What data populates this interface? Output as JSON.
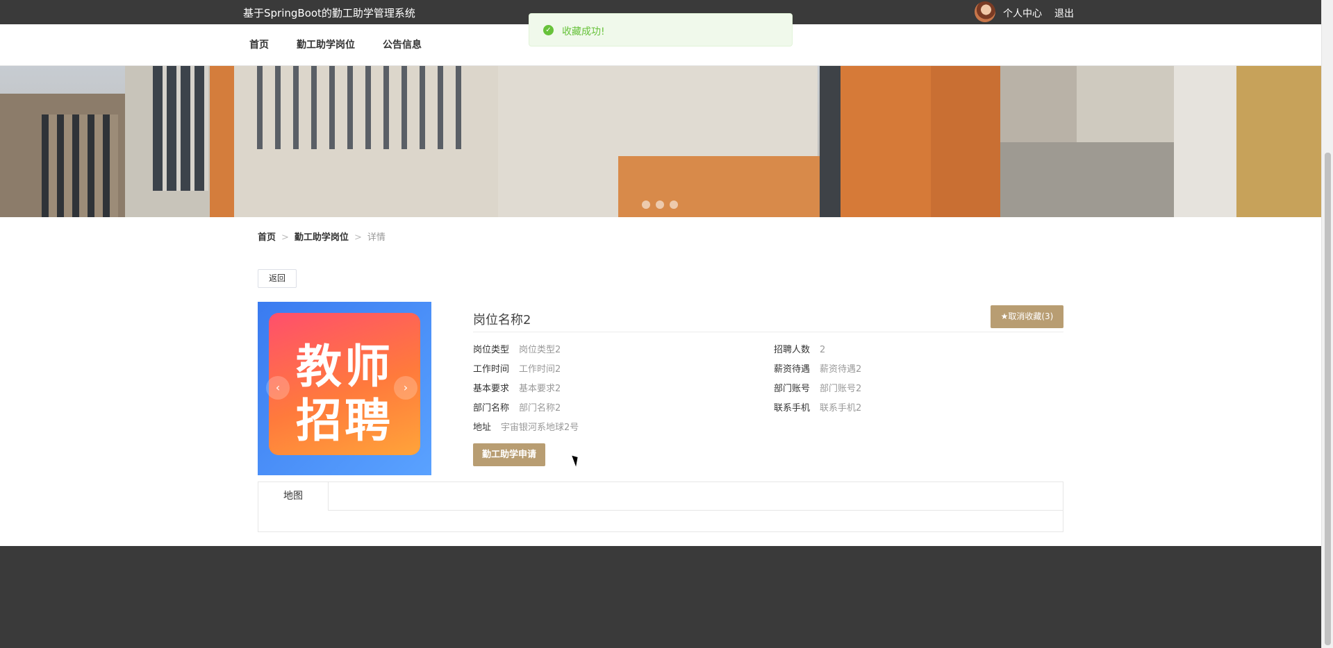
{
  "header": {
    "site_title": "基于SpringBoot的勤工助学管理系统",
    "user_center": "个人中心",
    "logout": "退出"
  },
  "nav": {
    "home": "首页",
    "jobs": "勤工助学岗位",
    "notices": "公告信息"
  },
  "toast": {
    "message": "收藏成功!",
    "icon": "check-circle-icon"
  },
  "breadcrumb": {
    "home": "首页",
    "jobs": "勤工助学岗位",
    "current": "详情",
    "separator": ">"
  },
  "back_label": "返回",
  "job": {
    "image_text_line1": "教师",
    "image_text_line2": "招聘",
    "title": "岗位名称2",
    "favorite_label": "★取消收藏(3)",
    "fields_left": [
      {
        "label": "岗位类型",
        "value": "岗位类型2"
      },
      {
        "label": "工作时间",
        "value": "工作时间2"
      },
      {
        "label": "基本要求",
        "value": "基本要求2"
      },
      {
        "label": "部门名称",
        "value": "部门名称2"
      },
      {
        "label": "地址",
        "value": "宇宙银河系地球2号"
      }
    ],
    "fields_right": [
      {
        "label": "招聘人数",
        "value": "2"
      },
      {
        "label": "薪资待遇",
        "value": "薪资待遇2"
      },
      {
        "label": "部门账号",
        "value": "部门账号2"
      },
      {
        "label": "联系手机",
        "value": "联系手机2"
      }
    ],
    "apply_label": "勤工助学申请"
  },
  "tabs": {
    "map": "地图"
  },
  "colors": {
    "topbar": "#3a3a3a",
    "accent": "#b89d72",
    "toast_bg": "#f0f9eb",
    "toast_text": "#67c23a"
  }
}
